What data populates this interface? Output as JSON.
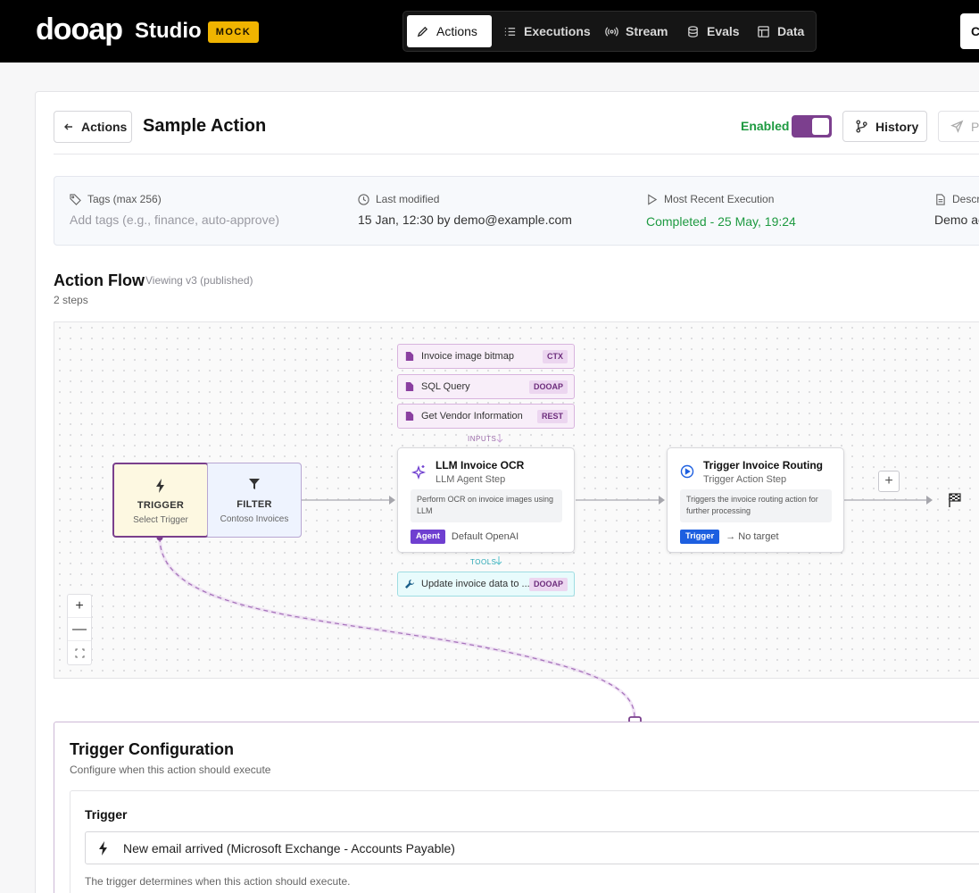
{
  "app": {
    "logo_text": "dooap",
    "product": "Studio",
    "badge": "MOCK",
    "account_initial": "C"
  },
  "nav": {
    "tabs": [
      {
        "label": "Actions",
        "icon": "pencil-icon",
        "active": true
      },
      {
        "label": "Executions",
        "icon": "list-icon",
        "active": false
      },
      {
        "label": "Stream",
        "icon": "broadcast-icon",
        "active": false
      },
      {
        "label": "Evals",
        "icon": "database-icon",
        "active": false
      },
      {
        "label": "Data",
        "icon": "table-icon",
        "active": false
      }
    ]
  },
  "header": {
    "back_label": "Actions",
    "title": "Sample Action",
    "enabled_label": "Enabled",
    "enabled": true,
    "history_label": "History",
    "publish_label": "P"
  },
  "meta": {
    "tags_label": "Tags (max 256)",
    "tags_placeholder": "Add tags (e.g., finance, auto-approve)",
    "modified_label": "Last modified",
    "modified_value": "15 Jan, 12:30 by demo@example.com",
    "execution_label": "Most Recent Execution",
    "execution_status": "Completed",
    "execution_time": " - 25 May, 19:24",
    "description_label": "Descr",
    "description_value": "Demo ac"
  },
  "flow": {
    "title": "Action Flow",
    "version": "Viewing v3 (published)",
    "steps": "2 steps",
    "trigger_node": {
      "name": "TRIGGER",
      "sub": "Select Trigger"
    },
    "filter_node": {
      "name": "FILTER",
      "sub": "Contoso Invoices"
    },
    "inputs": [
      {
        "label": "Invoice image bitmap",
        "tag": "CTX"
      },
      {
        "label": "SQL Query",
        "tag": "DOOAP"
      },
      {
        "label": "Get Vendor Information",
        "tag": "REST"
      }
    ],
    "inputs_caption": "INPUTS",
    "tools_caption": "TOOLS",
    "tool": {
      "label": "Update invoice data to ...",
      "tag": "DOOAP"
    },
    "llm_step": {
      "title": "LLM Invoice OCR",
      "type": "LLM Agent Step",
      "desc": "Perform OCR on invoice images using LLM",
      "chip": "Agent",
      "foot": "Default OpenAI"
    },
    "routing_step": {
      "title": "Trigger Invoice Routing",
      "type": "Trigger Action Step",
      "desc": "Triggers the invoice routing action for further processing",
      "chip": "Trigger",
      "foot": "→ No target"
    },
    "zoom": {
      "in": "+",
      "out": "—"
    }
  },
  "config": {
    "title": "Trigger Configuration",
    "subtitle": "Configure when this action should execute",
    "trigger_label": "Trigger",
    "trigger_value": "New email arrived (Microsoft Exchange - Accounts Payable)",
    "help": "The trigger determines when this action should execute."
  },
  "colors": {
    "accent": "#7a3f8d",
    "success": "#1e9a41",
    "agent": "#6f3fd0",
    "trigger": "#1d5fe0",
    "mock": "#f0b400"
  }
}
